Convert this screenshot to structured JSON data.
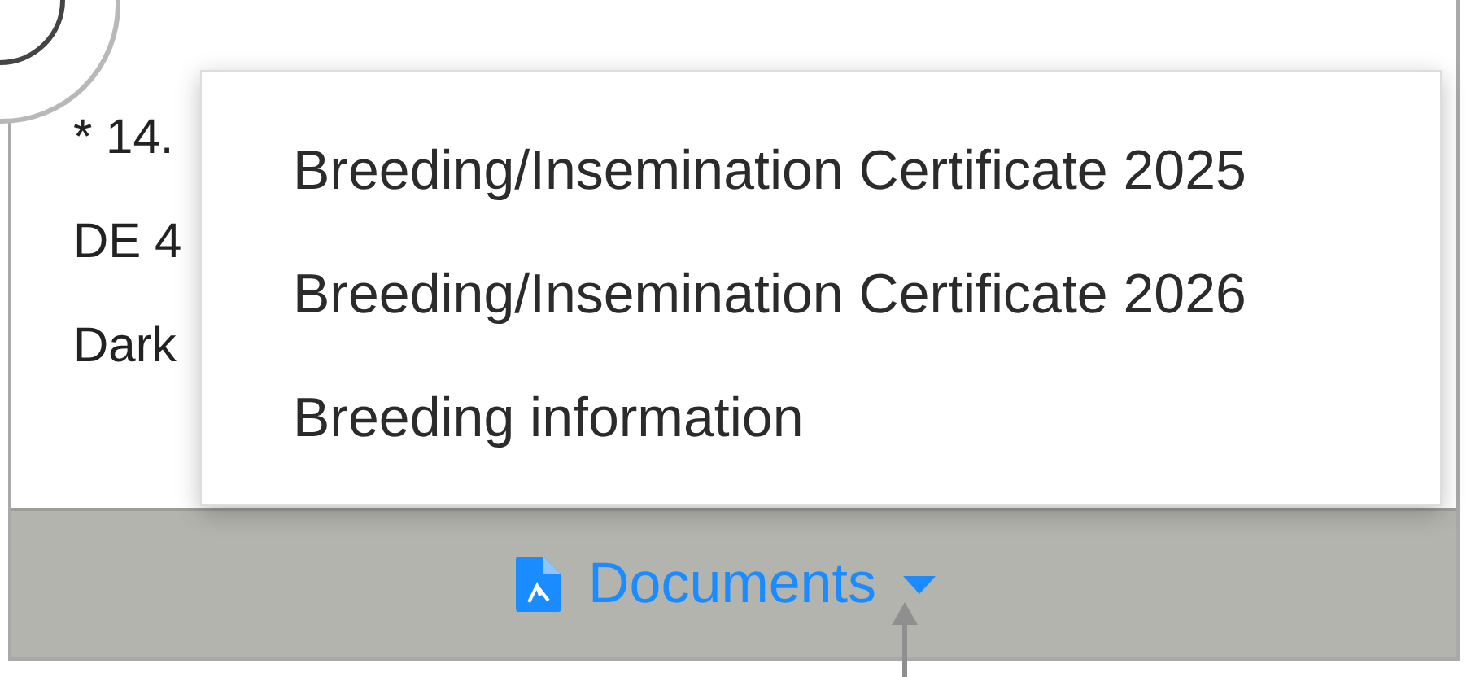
{
  "card_lines": [
    "* 14.",
    "DE 4",
    "Dark"
  ],
  "dropdown_menu": {
    "items": [
      {
        "label": "Breeding/Insemination Certificate 2025"
      },
      {
        "label": "Breeding/Insemination Certificate 2026"
      },
      {
        "label": "Breeding information"
      }
    ]
  },
  "footer": {
    "button": "Documents"
  }
}
